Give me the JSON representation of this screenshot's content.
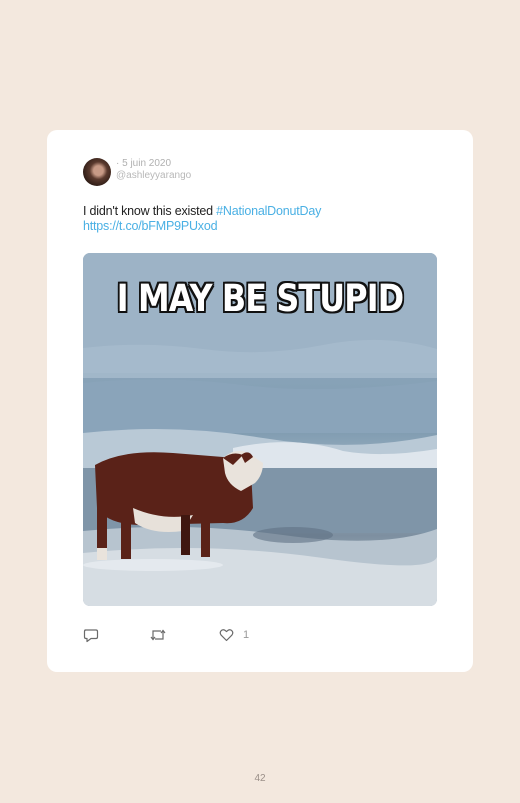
{
  "tweet": {
    "date": "· 5 juin 2020",
    "handle": "@ashleyyarango",
    "text": "I didn't know this existed ",
    "hashtag": "#NationalDonutDay",
    "link": "https://t.co/bFMP9PUxod",
    "media_caption": "I MAY BE STUPID",
    "like_count": "1"
  },
  "icons": {
    "reply": "reply-icon",
    "retweet": "retweet-icon",
    "like": "heart-icon"
  },
  "page": {
    "number": "42"
  },
  "colors": {
    "background": "#f3e8de",
    "card": "#ffffff",
    "link": "#4ab0e4",
    "text": "#222222"
  }
}
